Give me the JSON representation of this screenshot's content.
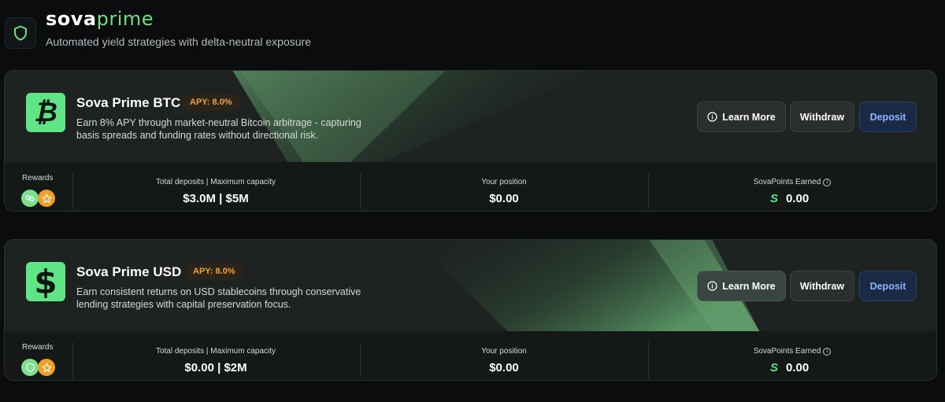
{
  "header": {
    "brand_part1": "sova",
    "brand_part2": "prime",
    "subtitle": "Automated yield strategies with delta-neutral exposure",
    "icon": "shield-icon"
  },
  "colors": {
    "accent_green": "#5fe586",
    "apy_orange": "#f2a23c",
    "deposit_blue": "#8ab4ff",
    "background": "#0b0c0d"
  },
  "products": [
    {
      "name": "Sova Prime BTC",
      "apy": "APY: 8.0%",
      "icon": "bitcoin-icon",
      "coin_glyph": "₿",
      "description": "Earn 8% APY through market-neutral Bitcoin arbitrage - capturing basis spreads and funding rates without directional risk.",
      "buttons": {
        "learn_more": "Learn More",
        "withdraw": "Withdraw",
        "deposit": "Deposit"
      },
      "rewards_label": "Rewards",
      "deposits_label": "Total deposits | Maximum capacity",
      "deposits_value": "$3.0M | $5M",
      "position_label": "Your position",
      "position_value": "$0.00",
      "points_label": "SovaPoints Earned",
      "points_value": "0.00"
    },
    {
      "name": "Sova Prime USD",
      "apy": "APY: 8.0%",
      "icon": "dollar-icon",
      "coin_glyph": "$",
      "description": "Earn consistent returns on USD stablecoins through conservative lending strategies with capital preservation focus.",
      "buttons": {
        "learn_more": "Learn More",
        "withdraw": "Withdraw",
        "deposit": "Deposit"
      },
      "rewards_label": "Rewards",
      "deposits_label": "Total deposits | Maximum capacity",
      "deposits_value": "$0.00 | $2M",
      "position_label": "Your position",
      "position_value": "$0.00",
      "points_label": "SovaPoints Earned",
      "points_value": "0.00"
    }
  ]
}
